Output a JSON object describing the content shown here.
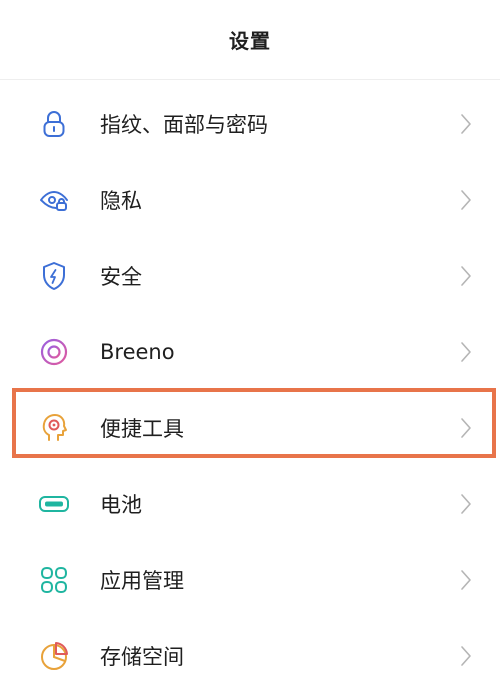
{
  "header": {
    "title": "设置"
  },
  "settings": {
    "items": [
      {
        "label": "指纹、面部与密码",
        "icon": "lock-icon",
        "color": "#3d6fd6"
      },
      {
        "label": "隐私",
        "icon": "privacy-eye-lock-icon",
        "color": "#3d6fd6"
      },
      {
        "label": "安全",
        "icon": "shield-bolt-icon",
        "color": "#3d6fd6"
      },
      {
        "label": "Breeno",
        "icon": "breeno-ring-icon",
        "color": "#c45bc8"
      },
      {
        "label": "便捷工具",
        "icon": "head-target-icon",
        "color": "#e8a23a"
      },
      {
        "label": "电池",
        "icon": "battery-icon",
        "color": "#1fb5a0"
      },
      {
        "label": "应用管理",
        "icon": "app-grid-icon",
        "color": "#1fb5a0"
      },
      {
        "label": "存储空间",
        "icon": "storage-pie-icon",
        "color": "#e8a23a"
      }
    ]
  },
  "highlight": {
    "color": "#e8744a",
    "target_item": "便捷工具"
  }
}
